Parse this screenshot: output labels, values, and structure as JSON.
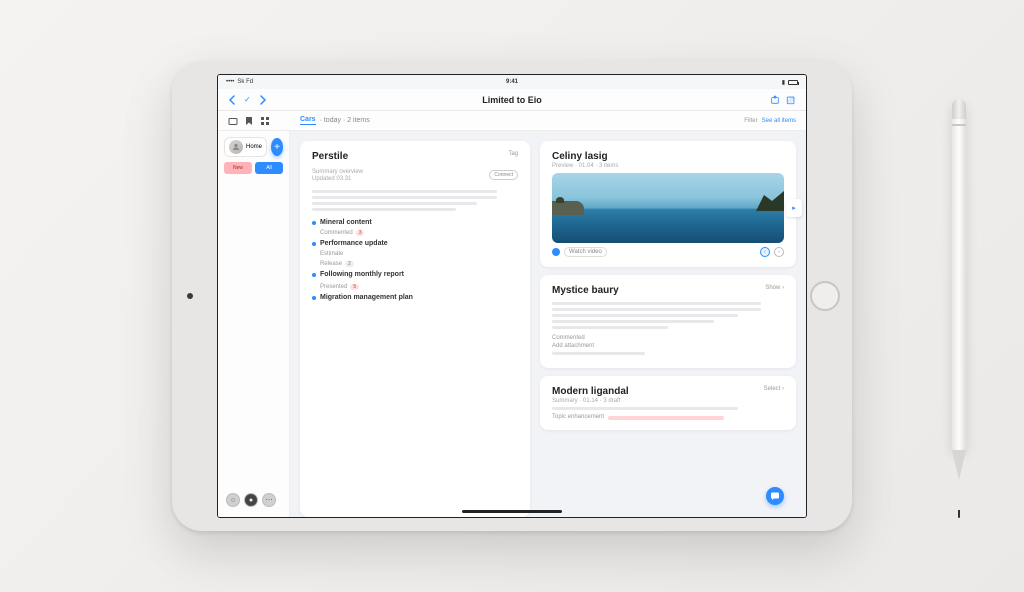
{
  "status": {
    "time": "9:41",
    "carrier_text": "Sk Fd"
  },
  "nav": {
    "title": "Limited to Eio"
  },
  "tabs": {
    "active": "Cars",
    "trail": "· today · 2 items",
    "right_label": "Filter",
    "right_link": "See all items"
  },
  "sidebar": {
    "avatar_label": "Home",
    "pill_red": "New",
    "pill_blue": "All"
  },
  "cards": {
    "profile": {
      "title": "Perstile",
      "tag": "Tag",
      "subtitle1": "Summary overview",
      "subtitle2": "Updated 03.31",
      "action": "Connect",
      "sec1": "Mineral content",
      "sec1_sub": "Commented",
      "sec1_tag": "3",
      "sec2": "Performance update",
      "sec2_sub": "Estimate",
      "sec3": "Release",
      "sec3_tag": "2",
      "sec4": "Following monthly report",
      "sec5": "Presented",
      "sec5_tag": "5",
      "sec6": "Migration management plan"
    },
    "gallery": {
      "title": "Celiny lasig",
      "sub": "Preview · 01.04 · 3 items",
      "chip": "Watch video"
    },
    "mystery": {
      "title": "Mystice baury",
      "link": "Show ›",
      "foot1": "Commented",
      "foot2": "Add attachment"
    },
    "modern": {
      "title": "Modern ligandal",
      "sub": "Summary · 01.14 · 3 draft",
      "link": "Select ›",
      "foot": "Topic enhancement"
    }
  }
}
